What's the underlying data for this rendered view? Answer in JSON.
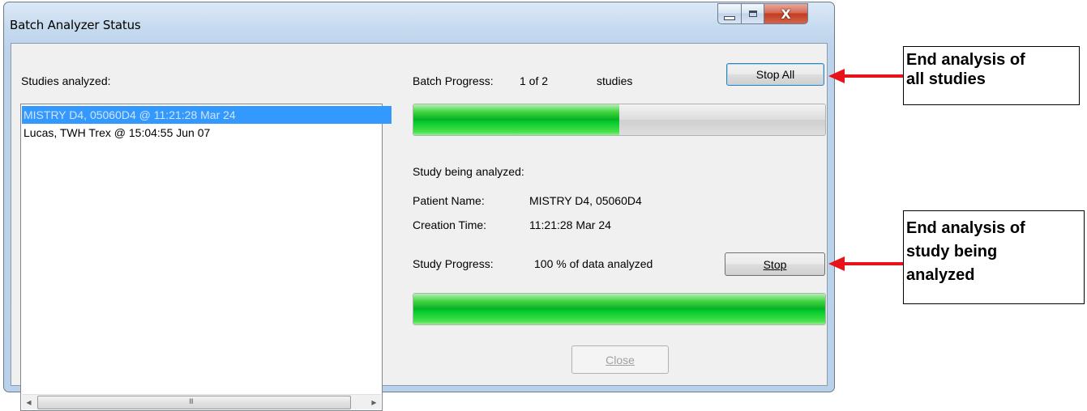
{
  "window": {
    "title": "Batch Analyzer Status",
    "minimize_icon": "minimize-icon",
    "maximize_icon": "maximize-icon",
    "close_icon": "close-icon",
    "close_glyph": "X"
  },
  "studies_list": {
    "label": "Studies analyzed:",
    "items": [
      {
        "text": "MISTRY D4, 05060D4 @ 11:21:28 Mar 24",
        "selected": true
      },
      {
        "text": "Lucas, TWH Trex @ 15:04:55 Jun 07",
        "selected": false
      }
    ],
    "scroll_left_glyph": "◀",
    "scroll_right_glyph": "▶",
    "thumb_grip": "III"
  },
  "batch": {
    "label": "Batch Progress:",
    "count": "1 of 2",
    "unit": "studies",
    "stop_all_label": "Stop All",
    "progress_fraction": 0.5
  },
  "study": {
    "heading": "Study being analyzed:",
    "patient_label": "Patient Name:",
    "patient_value": "MISTRY D4, 05060D4",
    "creation_label": "Creation Time:",
    "creation_value": "11:21:28 Mar 24",
    "progress_label": "Study Progress:",
    "progress_text": "100 % of data analyzed",
    "stop_label": "Stop",
    "progress_fraction": 1.0
  },
  "close_label": "Close",
  "colors": {
    "selection": "#3399ff",
    "progress_green": "#06b025",
    "arrow_red": "#e8121a"
  },
  "callouts": {
    "stop_all": [
      "End analysis of",
      "all studies"
    ],
    "stop": [
      "End analysis of",
      "study being",
      "analyzed"
    ]
  }
}
